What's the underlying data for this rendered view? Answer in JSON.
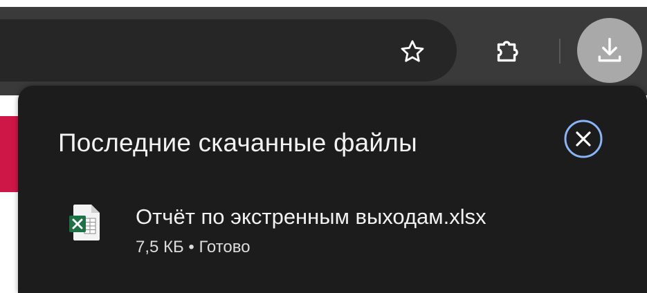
{
  "toolbar": {
    "favorite_icon": "star-outline-icon",
    "extensions_icon": "puzzle-piece-icon",
    "downloads_icon": "download-icon"
  },
  "downloads_panel": {
    "title": "Последние скачанные файлы",
    "close_icon": "close-circle-icon",
    "items": [
      {
        "file_name": "Отчёт по экстренным выходам.xlsx",
        "status_line": "7,5 КБ • Готово",
        "icon": "excel-file-icon"
      }
    ]
  },
  "colors": {
    "panel_bg": "#1c1c1c",
    "toolbar_bg": "#3a3a3a",
    "address_bar_bg": "#262626",
    "downloads_button_bg": "#a9a9a9",
    "close_accent": "#8ab4f8",
    "page_accent": "#cf1747",
    "excel_green": "#1e7145"
  }
}
